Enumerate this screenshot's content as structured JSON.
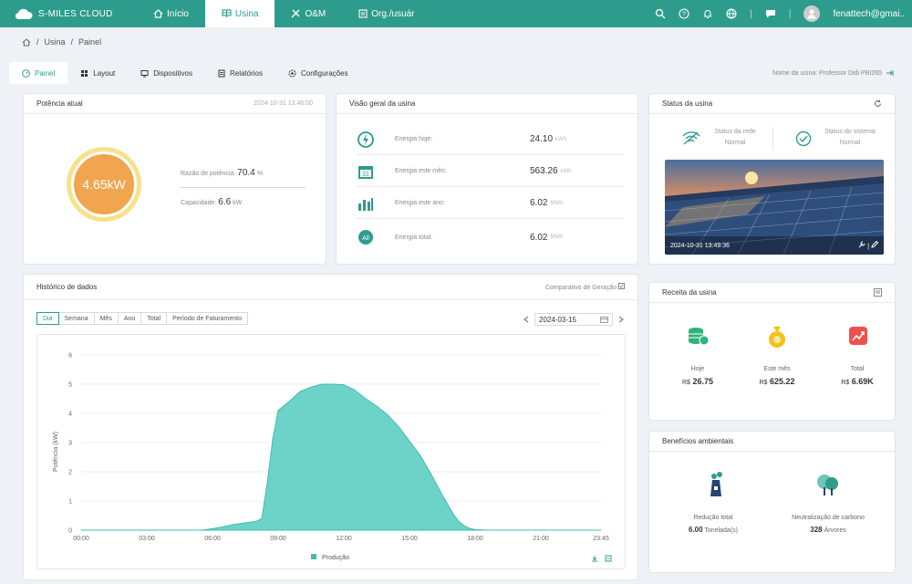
{
  "brand": "S-MILES CLOUD",
  "nav": {
    "home": "Início",
    "plant": "Usina",
    "om": "O&M",
    "org": "Org./usuár"
  },
  "user": {
    "email": "fenattech@gmai.."
  },
  "breadcrumb": {
    "part1": "Usina",
    "part2": "Painel"
  },
  "tabs": {
    "panel": "Painel",
    "layout": "Layout",
    "devices": "Dispositivos",
    "reports": "Relatórios",
    "settings": "Configurações"
  },
  "plant_name": "Nome da usina: Professor Didi PBI265",
  "power_card": {
    "title": "Potência atual",
    "timestamp": "2024-10-31 13:46:00",
    "value": "4.65kW",
    "ratio_label": "Razão de potência:",
    "ratio_value": "70.4",
    "ratio_unit": "%",
    "capacity_label": "Capacidade:",
    "capacity_value": "6.6",
    "capacity_unit": "kW"
  },
  "overview": {
    "title": "Visão geral da usina",
    "rows": [
      {
        "label": "Energia hoje:",
        "value": "24.10",
        "unit": "kWh"
      },
      {
        "label": "Energia este mês:",
        "value": "563.26",
        "unit": "kWh"
      },
      {
        "label": "Energia este ano:",
        "value": "6.02",
        "unit": "MWh"
      },
      {
        "label": "Energia total:",
        "value": "6.02",
        "unit": "MWh"
      }
    ]
  },
  "status": {
    "title": "Status da usina",
    "grid_label": "Status da rede",
    "grid_value": "Normal",
    "system_label": "Status do sistema",
    "system_value": "Normal",
    "image_timestamp": "2024-10-31 13:49:36"
  },
  "history": {
    "title": "Histórico de dados",
    "compare": "Comparativo de Geração",
    "periods": [
      "Dia",
      "Semana",
      "Mês",
      "Ano",
      "Total",
      "Período de Faturamento"
    ],
    "date": "2024-03-15"
  },
  "chart_data": {
    "type": "area",
    "xlabel": "",
    "ylabel": "Potência (kW)",
    "ylim": [
      0,
      6
    ],
    "yticks": [
      0,
      1,
      2,
      3,
      4,
      5,
      6
    ],
    "xticks": [
      "00:00",
      "03:00",
      "06:00",
      "09:00",
      "12:00",
      "15:00",
      "18:00",
      "21:00",
      "23:45"
    ],
    "legend": "Produção",
    "color": "#6dd3c8",
    "x": [
      0,
      5.5,
      6,
      6.5,
      7,
      7.5,
      8,
      8.25,
      8.5,
      8.75,
      9,
      9.5,
      10,
      10.5,
      11,
      11.5,
      12,
      12.5,
      13,
      13.5,
      14,
      14.5,
      15,
      15.5,
      16,
      16.5,
      17,
      17.25,
      17.5,
      17.75,
      18,
      18.5,
      23.75
    ],
    "y": [
      0,
      0,
      0.05,
      0.12,
      0.2,
      0.25,
      0.3,
      0.4,
      1.6,
      3.1,
      4.1,
      4.4,
      4.75,
      4.9,
      5.0,
      5.0,
      4.98,
      4.8,
      4.5,
      4.25,
      3.95,
      3.55,
      3.05,
      2.55,
      1.9,
      1.2,
      0.55,
      0.3,
      0.15,
      0.06,
      0.02,
      0,
      0
    ]
  },
  "revenue": {
    "title": "Receita da usina",
    "items": [
      {
        "label": "Hoje",
        "currency": "R$",
        "value": "26.75"
      },
      {
        "label": "Este mês",
        "currency": "R$",
        "value": "625.22"
      },
      {
        "label": "Total",
        "currency": "R$",
        "value": "6.69K"
      }
    ]
  },
  "environment": {
    "title": "Benefícios ambientais",
    "reduction_label": "Redução total",
    "reduction_value": "6.00",
    "reduction_unit": "Tonelada(s)",
    "carbon_label": "Neutralização de carbono",
    "carbon_value": "328",
    "carbon_unit": "Árvores"
  }
}
